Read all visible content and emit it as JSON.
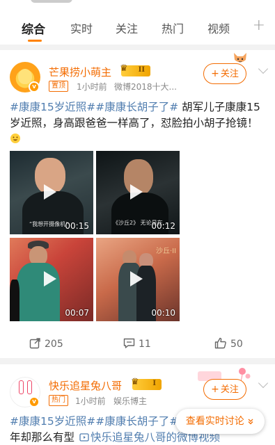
{
  "tabs": [
    {
      "label": "综合",
      "active": true
    },
    {
      "label": "实时",
      "active": false
    },
    {
      "label": "关注",
      "active": false
    },
    {
      "label": "热门",
      "active": false
    },
    {
      "label": "视频",
      "active": false
    }
  ],
  "tab_add_label": "+",
  "accent_color": "#ff8200",
  "topic_color": "#507daf",
  "posts": [
    {
      "username": "芒果捞小萌主",
      "level_badge": "II",
      "tag": "置顶",
      "time": "1小时前",
      "source": "微博2018十大...",
      "follow_label": "关注",
      "topics": [
        "#康康15岁近照#",
        "#康康长胡子了#"
      ],
      "text": " 胡军儿子康康15岁近照，身高跟爸爸一样高了，怼脸拍小胡子抢镜！",
      "emoji_icon": "grin-emoji-icon",
      "videos": [
        {
          "duration": "00:15",
          "caption": "“我想开摄像机”"
        },
        {
          "duration": "00:12",
          "caption": "《沙丘2》 无论是在..."
        },
        {
          "duration": "00:07",
          "caption": ""
        },
        {
          "duration": "00:10",
          "caption": "沙丘·II"
        }
      ],
      "reposts": "205",
      "comments": "11",
      "likes": "50"
    },
    {
      "username": "快乐追星兔八哥",
      "level_badge": "I",
      "tag": "热门",
      "time": "1小时前",
      "source": "娱乐博主",
      "follow_label": "关注",
      "topics": [
        "#康康15岁近照#",
        "#康康长胡子了#"
      ],
      "text": "年却那么有型",
      "video_link": "快乐追星兔八哥的微博视频"
    }
  ],
  "floating_button": "查看实时讨论"
}
